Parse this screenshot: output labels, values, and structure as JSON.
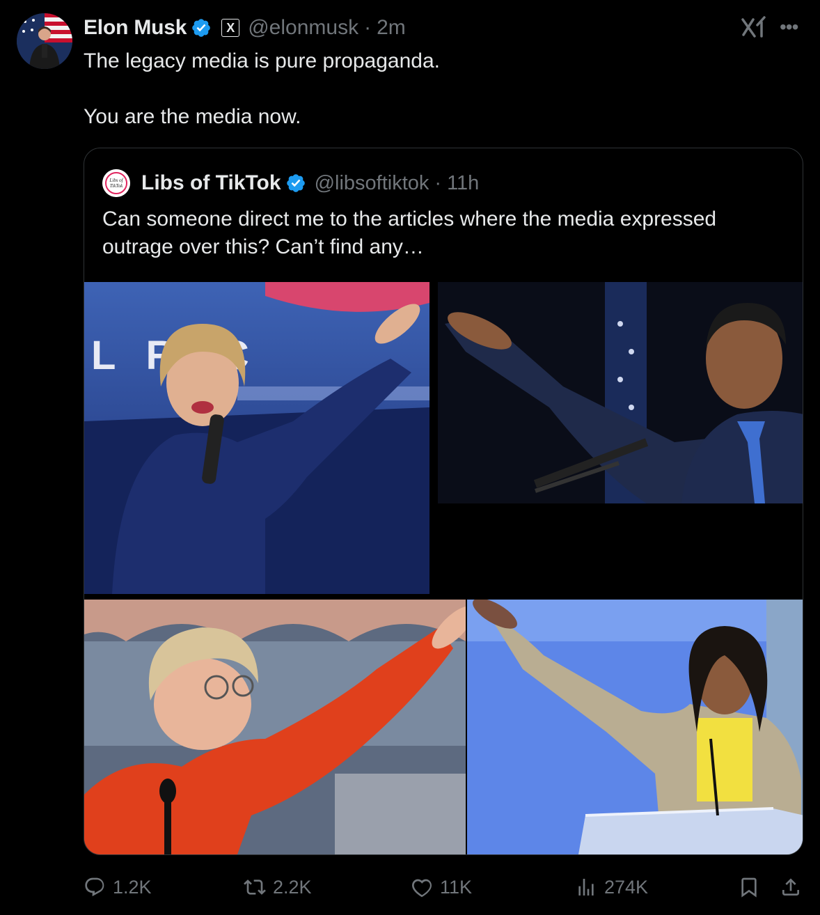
{
  "tweet": {
    "author_name": "Elon Musk",
    "handle": "@elonmusk",
    "separator": "·",
    "time": "2m",
    "affiliation_badge": "X",
    "text_lines": [
      "The legacy media is pure propaganda.",
      "You are the media now."
    ],
    "avatar_icon": "elon-musk-avatar",
    "verified_color": "#1d9bf0"
  },
  "quoted": {
    "author_name": "Libs of TikTok",
    "handle": "@libsoftiktok",
    "separator": "·",
    "time": "11h",
    "text": "Can someone direct me to the articles where the media expressed outrage over this? Can’t find any…",
    "avatar_text_1": "Libs of",
    "avatar_text_2": "TikTok",
    "media_stage_sign": "L RYC"
  },
  "actions": {
    "replies": "1.2K",
    "reposts": "2.2K",
    "likes": "11K",
    "views": "274K"
  },
  "icons": {
    "reply": "reply-icon",
    "repost": "repost-icon",
    "like": "heart-icon",
    "views": "views-icon",
    "bookmark": "bookmark-icon",
    "share": "share-icon",
    "more": "more-icon",
    "grok": "grok-icon"
  },
  "colors": {
    "background": "#000000",
    "text": "#e7e9ea",
    "muted": "#71767b",
    "border": "#2f3336",
    "accent": "#1d9bf0"
  }
}
